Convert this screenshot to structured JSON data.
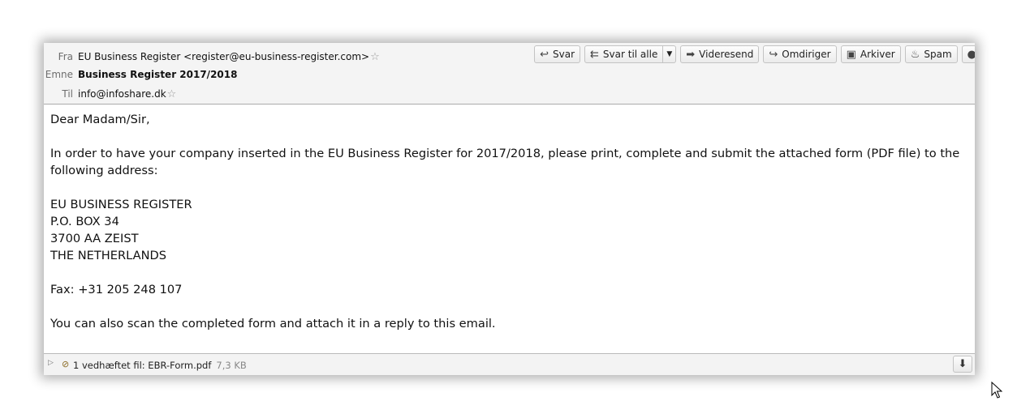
{
  "header": {
    "from_label": "Fra",
    "from_value": "EU Business Register <register@eu-business-register.com>",
    "subject_label": "Emne",
    "subject_value": "Business Register 2017/2018",
    "to_label": "Til",
    "to_value": "info@infoshare.dk"
  },
  "toolbar": {
    "reply": "Svar",
    "reply_all": "Svar til alle",
    "forward": "Videresend",
    "redirect": "Omdiriger",
    "archive": "Arkiver",
    "spam": "Spam"
  },
  "body": {
    "greeting": "Dear Madam/Sir,",
    "para1": "In order to have your company inserted in the EU Business Register for 2017/2018, please print, complete and submit the attached form (PDF file) to the following address:",
    "address": [
      "EU BUSINESS REGISTER",
      "P.O. BOX 34",
      "3700 AA ZEIST",
      "THE NETHERLANDS"
    ],
    "fax": "Fax: +31 205 248 107",
    "para2": "You can also scan the completed form and attach it in a reply to this email."
  },
  "attachment": {
    "label": "1 vedhæftet fil: EBR-Form.pdf",
    "size": "7,3 KB"
  },
  "icons": {
    "star": "star-outline-icon",
    "reply": "reply-arrow-icon",
    "reply_all": "reply-all-arrow-icon",
    "forward": "forward-arrow-icon",
    "redirect": "redirect-arrow-icon",
    "archive": "archive-box-icon",
    "spam": "flame-icon",
    "paperclip": "paperclip-icon",
    "download": "download-arrow-icon"
  }
}
